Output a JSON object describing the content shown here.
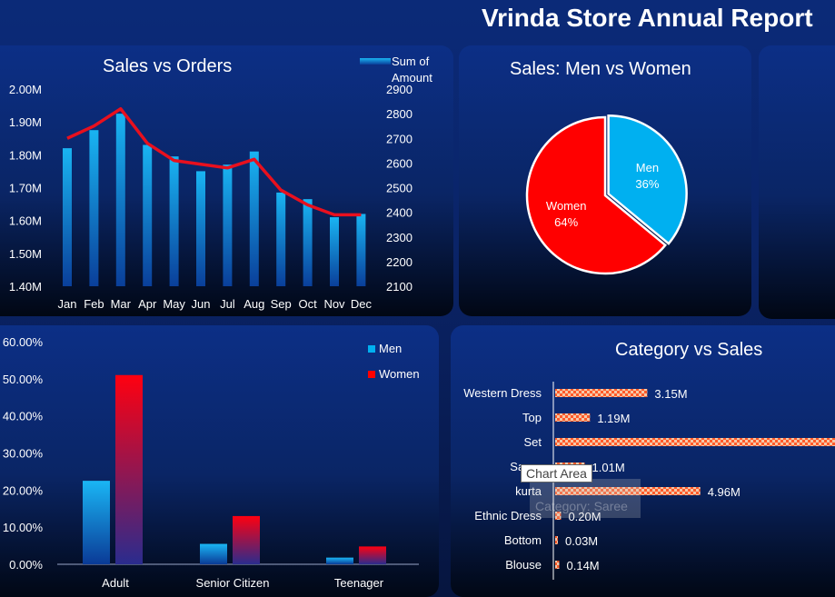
{
  "page": {
    "title": "Vrinda Store Annual Report"
  },
  "colors": {
    "blue": "#00b0f0",
    "red": "#ff0000",
    "line": "#e8101e"
  },
  "panels": {
    "sales_orders": {
      "title": "Sales vs Orders"
    },
    "men_women": {
      "title": "Sales: Men vs Women"
    },
    "category": {
      "title": "Category vs Sales"
    }
  },
  "tooltip": {
    "label": "Chart Area",
    "ghost": "Category: Saree"
  },
  "chart_data": [
    {
      "type": "bar+line",
      "title": "Sales vs Orders",
      "categories": [
        "Jan",
        "Feb",
        "Mar",
        "Apr",
        "May",
        "Jun",
        "Jul",
        "Aug",
        "Sep",
        "Oct",
        "Nov",
        "Dec"
      ],
      "legend": [
        "Sum of",
        "Amount"
      ],
      "series": [
        {
          "name": "Sum of Amount",
          "type": "bar",
          "axis": "left",
          "values": [
            1.82,
            1.875,
            1.925,
            1.83,
            1.795,
            1.75,
            1.77,
            1.81,
            1.685,
            1.665,
            1.61,
            1.62
          ]
        },
        {
          "type": "line",
          "axis": "right",
          "values": [
            2700,
            2750,
            2820,
            2680,
            2610,
            2595,
            2580,
            2615,
            2490,
            2430,
            2390,
            2390
          ]
        }
      ],
      "y_left": {
        "ticks": [
          "2.00M",
          "1.90M",
          "1.80M",
          "1.70M",
          "1.60M",
          "1.50M",
          "1.40M"
        ],
        "min": 1.4,
        "max": 2.0
      },
      "y_right": {
        "ticks": [
          "2900",
          "2800",
          "2700",
          "2600",
          "2500",
          "2400",
          "2300",
          "2200",
          "2100"
        ],
        "min": 2100,
        "max": 2900
      },
      "grid": false,
      "legend_position": "top-right"
    },
    {
      "type": "pie",
      "title": "Sales: Men vs Women",
      "slices": [
        {
          "label": "Men",
          "value": 36,
          "display": "36%"
        },
        {
          "label": "Women",
          "value": 64,
          "display": "64%"
        }
      ]
    },
    {
      "type": "bar",
      "categories": [
        "Adult",
        "Senior Citizen",
        "Teenager"
      ],
      "series": [
        {
          "name": "Men",
          "values": [
            22.5,
            5.5,
            1.8
          ]
        },
        {
          "name": "Women",
          "values": [
            51,
            13,
            4.8
          ]
        }
      ],
      "y_ticks": [
        "60.00%",
        "50.00%",
        "40.00%",
        "30.00%",
        "20.00%",
        "10.00%",
        "0.00%"
      ],
      "ylim": [
        0,
        60
      ],
      "legend_position": "top-right"
    },
    {
      "type": "bar",
      "orientation": "horizontal",
      "title": "Category vs Sales",
      "categories": [
        "Western Dress",
        "Top",
        "Set",
        "Saree",
        "kurta",
        "Ethnic Dress",
        "Bottom",
        "Blouse"
      ],
      "values": [
        3.15,
        1.19,
        10.0,
        1.01,
        4.96,
        0.2,
        0.03,
        0.14
      ],
      "labels": [
        "3.15M",
        "1.19M",
        "",
        "1.01M",
        "4.96M",
        "0.20M",
        "0.03M",
        "0.14M"
      ]
    }
  ]
}
